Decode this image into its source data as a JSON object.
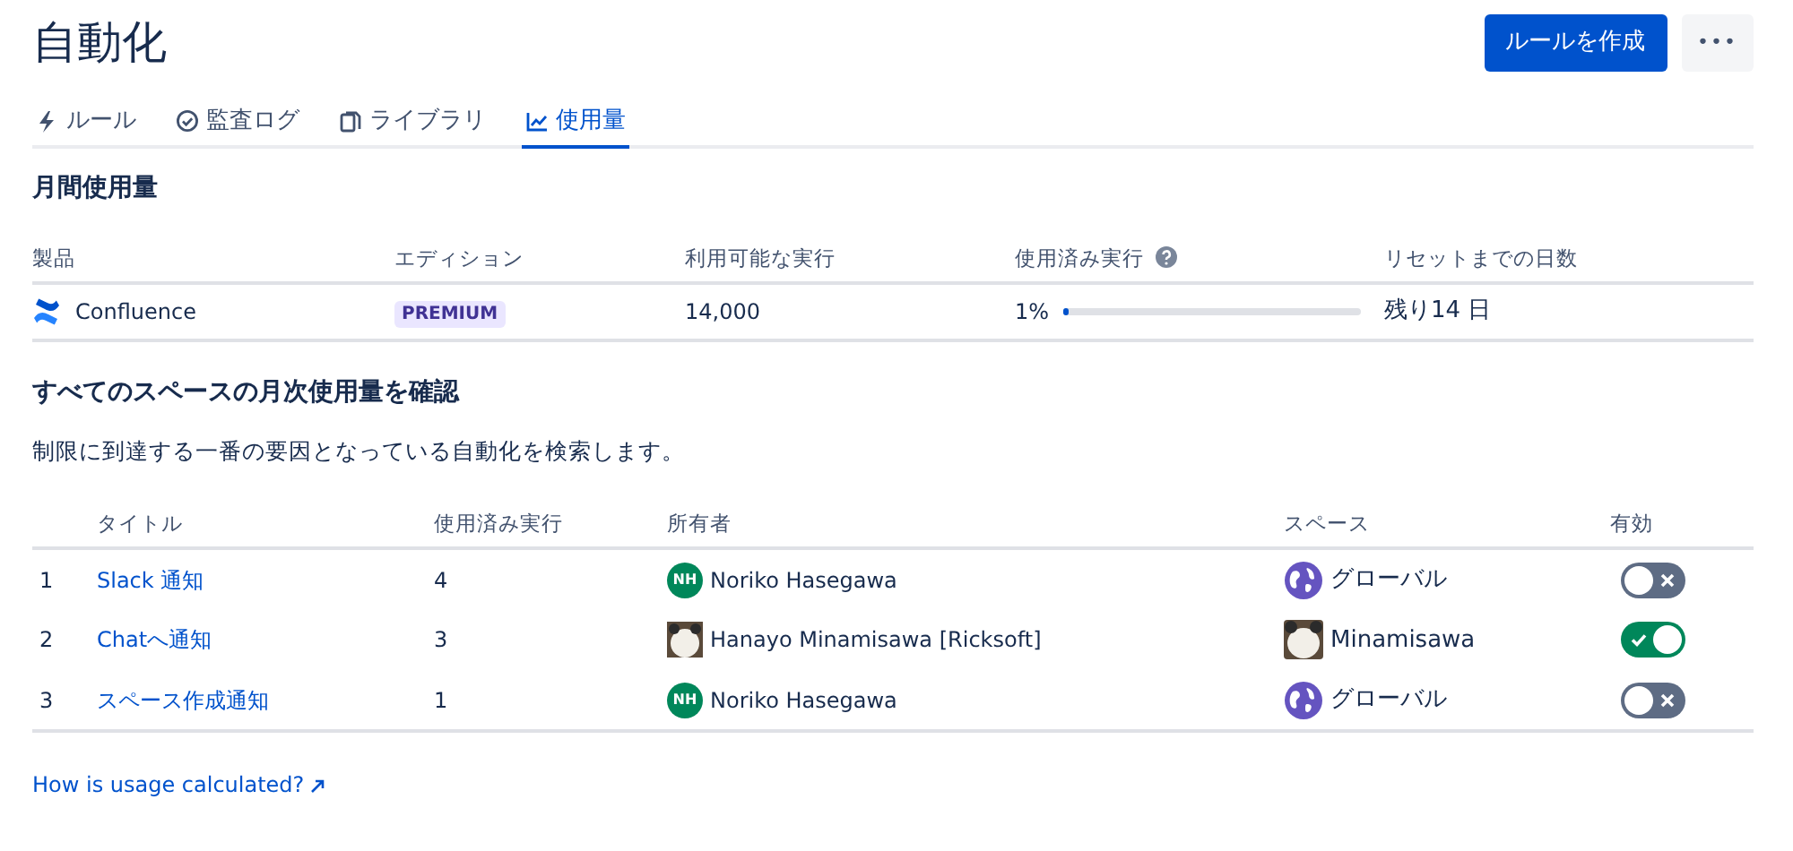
{
  "title": "自動化",
  "actions": {
    "create_button": "ルールを作成",
    "more_button": "•••"
  },
  "tabs": [
    {
      "label": "ルール",
      "kind": "bolt",
      "selected": false
    },
    {
      "label": "監査ログ",
      "kind": "check",
      "selected": false
    },
    {
      "label": "ライブラリ",
      "kind": "copy",
      "selected": false
    },
    {
      "label": "使用量",
      "kind": "chart",
      "selected": true
    }
  ],
  "monthly": {
    "heading": "月間使用量",
    "columns": [
      "製品",
      "エディション",
      "利用可能な実行",
      "使用済み実行",
      "リセットまでの日数"
    ],
    "row": {
      "product": "Confluence",
      "edition": "PREMIUM",
      "available": "14,000",
      "used_percent": "1%",
      "level": 0.01,
      "days_left": "残り14 日"
    }
  },
  "spaces": {
    "heading": "すべてのスペースの月次使用量を確認",
    "description": "制限に到達する一番の要因となっている自動化を検索します。",
    "columns": [
      "タイトル",
      "使用済み実行",
      "所有者",
      "スペース",
      "有効"
    ],
    "rows": [
      {
        "number": "1",
        "title": "Slack 通知",
        "used": "4",
        "owner": {
          "name": "Noriko Hasegawa",
          "kind": "initials",
          "initials": "NH"
        },
        "space": {
          "name": "グローバル",
          "kind": "globe"
        },
        "enabled": false
      },
      {
        "number": "2",
        "title": "Chatへ通知",
        "used": "3",
        "owner": {
          "name": "Hanayo Minamisawa [Ricksoft]",
          "kind": "picture"
        },
        "space": {
          "name": "Minamisawa",
          "kind": "picture"
        },
        "enabled": true
      },
      {
        "number": "3",
        "title": "スペース作成通知",
        "used": "1",
        "owner": {
          "name": "Noriko Hasegawa",
          "kind": "initials",
          "initials": "NH"
        },
        "space": {
          "name": "グローバル",
          "kind": "globe"
        },
        "enabled": false
      }
    ]
  },
  "footer_link": "How is usage calculated?"
}
